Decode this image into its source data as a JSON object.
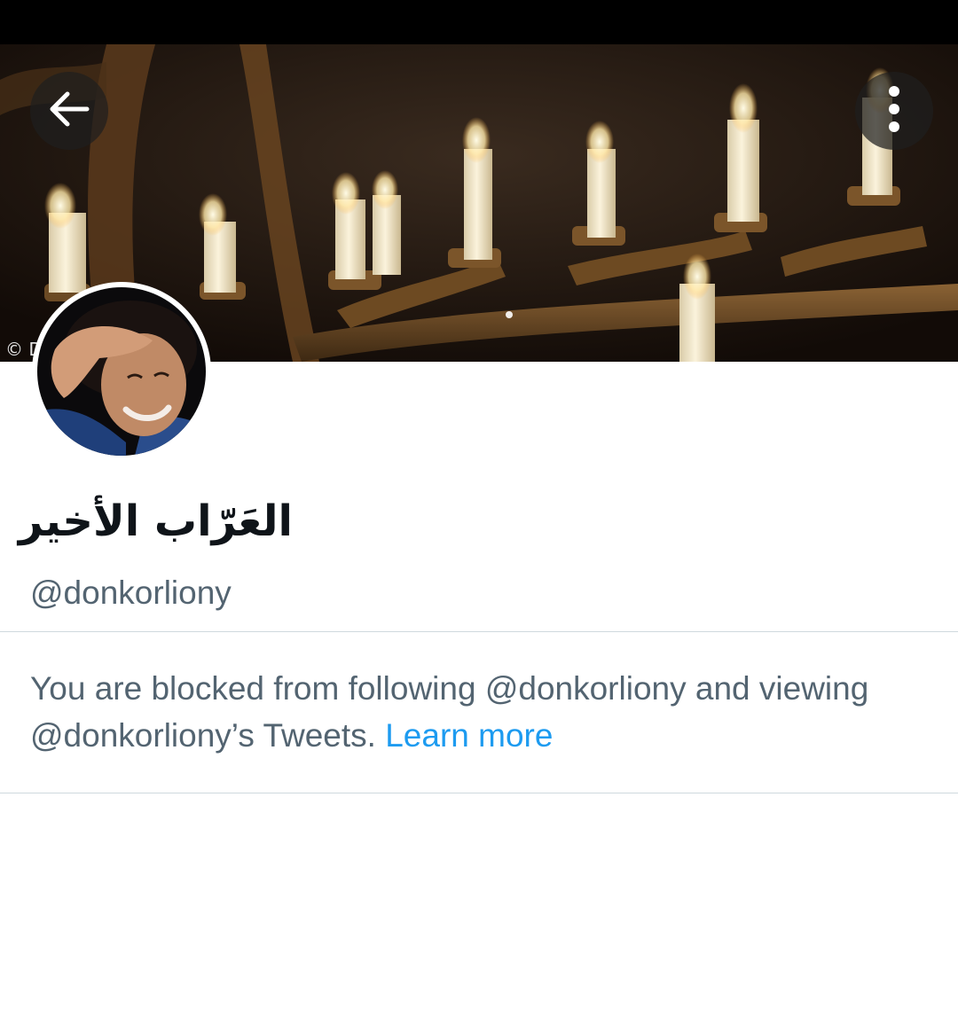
{
  "profile": {
    "display_name": "العَرّاب الأخير",
    "handle": "@donkorliony"
  },
  "banner": {
    "copyright": "© D"
  },
  "notice": {
    "message": "You are blocked from following @donkorliony and viewing @donkorliony’s Tweets. ",
    "link_label": "Learn more"
  },
  "icons": {
    "back": "arrow-left-icon",
    "more": "more-vertical-icon"
  },
  "colors": {
    "link": "#1d9bf0",
    "secondary_text": "#536471",
    "primary_text": "#0f1419",
    "divider": "#cfd9de"
  }
}
